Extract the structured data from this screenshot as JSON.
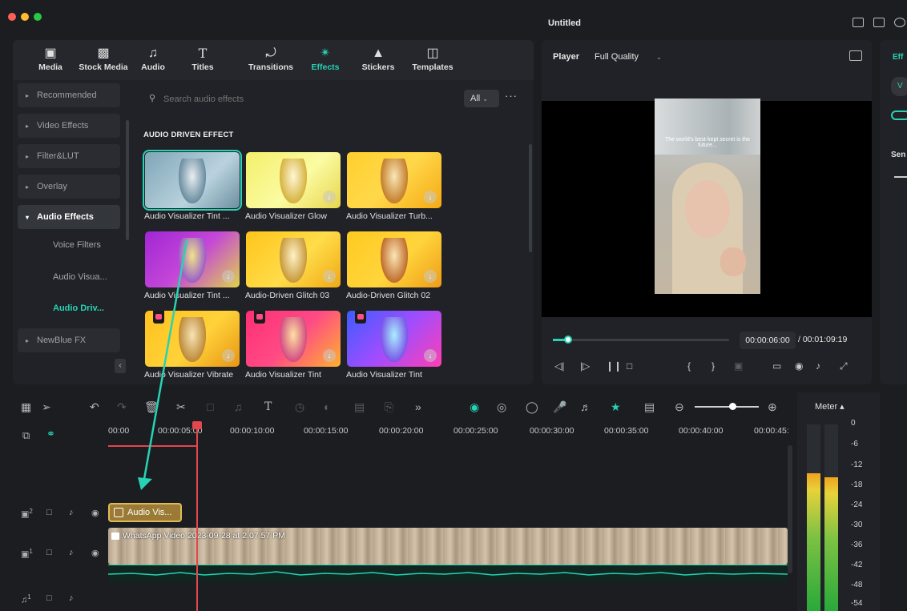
{
  "window": {
    "title": "Untitled"
  },
  "tabs": [
    {
      "label": "Media",
      "icon": "media-icon"
    },
    {
      "label": "Stock Media",
      "icon": "stock-media-icon"
    },
    {
      "label": "Audio",
      "icon": "music-note-icon"
    },
    {
      "label": "Titles",
      "icon": "text-icon"
    },
    {
      "label": "Transitions",
      "icon": "transition-icon"
    },
    {
      "label": "Effects",
      "icon": "effects-icon",
      "active": true
    },
    {
      "label": "Stickers",
      "icon": "stickers-icon"
    },
    {
      "label": "Templates",
      "icon": "templates-icon"
    }
  ],
  "sidebar": {
    "items": [
      {
        "label": "Recommended"
      },
      {
        "label": "Video Effects"
      },
      {
        "label": "Filter&LUT"
      },
      {
        "label": "Overlay"
      },
      {
        "label": "Audio Effects",
        "open": true
      },
      {
        "label": "NewBlue FX"
      }
    ],
    "subitems": [
      {
        "label": "Voice Filters"
      },
      {
        "label": "Audio Visua..."
      },
      {
        "label": "Audio Driv...",
        "active": true
      }
    ]
  },
  "search": {
    "placeholder": "Search audio effects",
    "filter": "All",
    "more": "···"
  },
  "section": {
    "heading": "AUDIO DRIVEN EFFECT"
  },
  "effects": [
    {
      "label": "Audio Visualizer Tint ...",
      "selected": true
    },
    {
      "label": "Audio Visualizer Glow"
    },
    {
      "label": "Audio Visualizer Turb..."
    },
    {
      "label": "Audio Visualizer Tint ..."
    },
    {
      "label": "Audio-Driven Glitch 03"
    },
    {
      "label": "Audio-Driven Glitch 02"
    },
    {
      "label": "Audio Visualizer Vibrate"
    },
    {
      "label": "Audio Visualizer Tint"
    },
    {
      "label": "Audio Visualizer Tint"
    }
  ],
  "player": {
    "label": "Player",
    "quality": "Full Quality",
    "overlay_text": "The world's best-kept secret is the future...",
    "current_time": "00:00:06:00",
    "total_time": "/ 00:01:09:19",
    "progress": 0.087
  },
  "right_panel": {
    "tab": "Eff",
    "pill": "V",
    "label": "Sen"
  },
  "timeline": {
    "ruler": [
      "00:00",
      "00:00:05:00",
      "00:00:10:00",
      "00:00:15:00",
      "00:00:20:00",
      "00:00:25:00",
      "00:00:30:00",
      "00:00:35:00",
      "00:00:40:00",
      "00:00:45:"
    ],
    "effect_clip": "Audio Vis...",
    "video_clip": "WhatsApp Video 2023-09-28 at 2.07.57 PM",
    "tracks": [
      {
        "number": "2"
      },
      {
        "number": "1"
      },
      {
        "number": "1"
      }
    ]
  },
  "meter": {
    "title": "Meter ▴",
    "scale": [
      "0",
      "-6",
      "-12",
      "-18",
      "-24",
      "-30",
      "-36",
      "-42",
      "-48",
      "-54"
    ],
    "levels": [
      0.74,
      0.72
    ]
  },
  "colors": {
    "accent": "#27d3b4",
    "playhead": "#e2464e",
    "clip": "#9a7a34"
  }
}
